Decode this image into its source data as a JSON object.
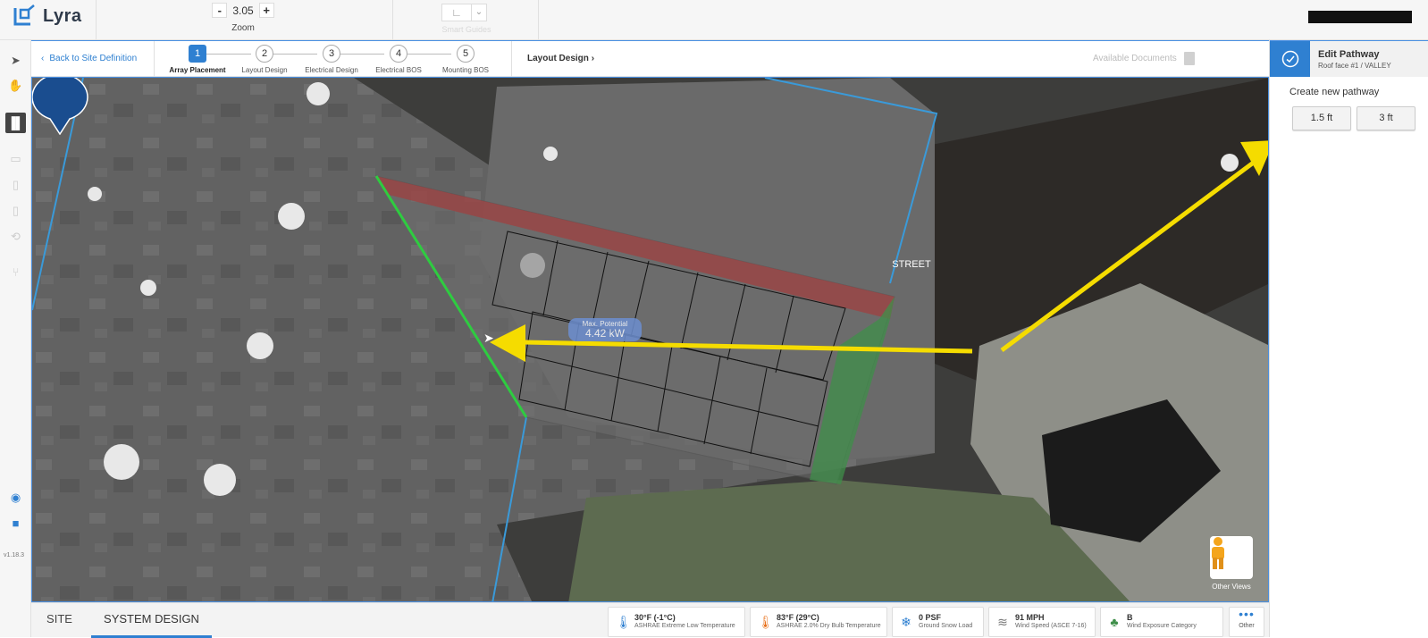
{
  "app": {
    "name": "Lyra"
  },
  "topbar": {
    "zoom_minus": "-",
    "zoom_value": "3.05",
    "zoom_plus": "+",
    "zoom_label": "Zoom",
    "smart_guides_label": "Smart Guides"
  },
  "toolbar": {
    "version": "v1.18.3"
  },
  "stepbar": {
    "back_label": "Back to Site Definition",
    "steps": [
      {
        "number": "1",
        "label": "Array Placement"
      },
      {
        "number": "2",
        "label": "Layout Design"
      },
      {
        "number": "3",
        "label": "Electrical Design"
      },
      {
        "number": "4",
        "label": "Electrical BOS"
      },
      {
        "number": "5",
        "label": "Mounting BOS"
      }
    ],
    "active_step": 1,
    "next_label": "Layout Design",
    "available_documents": "Available Documents"
  },
  "map": {
    "street_label": "STREET",
    "max_potential_label": "Max. Potential",
    "max_potential_value": "4.42 kW",
    "other_views_label": "Other Views"
  },
  "panel": {
    "title": "Edit Pathway",
    "subtitle": "Roof face #1 / VALLEY",
    "create_label": "Create new pathway",
    "options": [
      "1.5 ft",
      "3 ft"
    ]
  },
  "bottom": {
    "tabs": [
      "SITE",
      "SYSTEM DESIGN"
    ],
    "active_tab": "SYSTEM DESIGN",
    "weather": [
      {
        "icon": "thermometer-cold-icon",
        "value": "30°F (-1°C)",
        "label": "ASHRAE Extreme Low Temperature"
      },
      {
        "icon": "thermometer-hot-icon",
        "value": "83°F (29°C)",
        "label": "ASHRAE 2.0% Dry Bulb Temperature"
      },
      {
        "icon": "snowflake-icon",
        "value": "0 PSF",
        "label": "Ground Snow Load"
      },
      {
        "icon": "wind-icon",
        "value": "91 MPH",
        "label": "Wind Speed (ASCE 7-16)"
      },
      {
        "icon": "trees-icon",
        "value": "B",
        "label": "Wind Exposure Category"
      }
    ],
    "more_label": "Other"
  },
  "colors": {
    "accent": "#2f80d1",
    "annotation_arrow": "#f5dc00",
    "pathway": "#2ecc40",
    "setback_red": "#a83a3a",
    "setback_green": "#3f8f4a",
    "street_pin": "#1a4d8f"
  }
}
